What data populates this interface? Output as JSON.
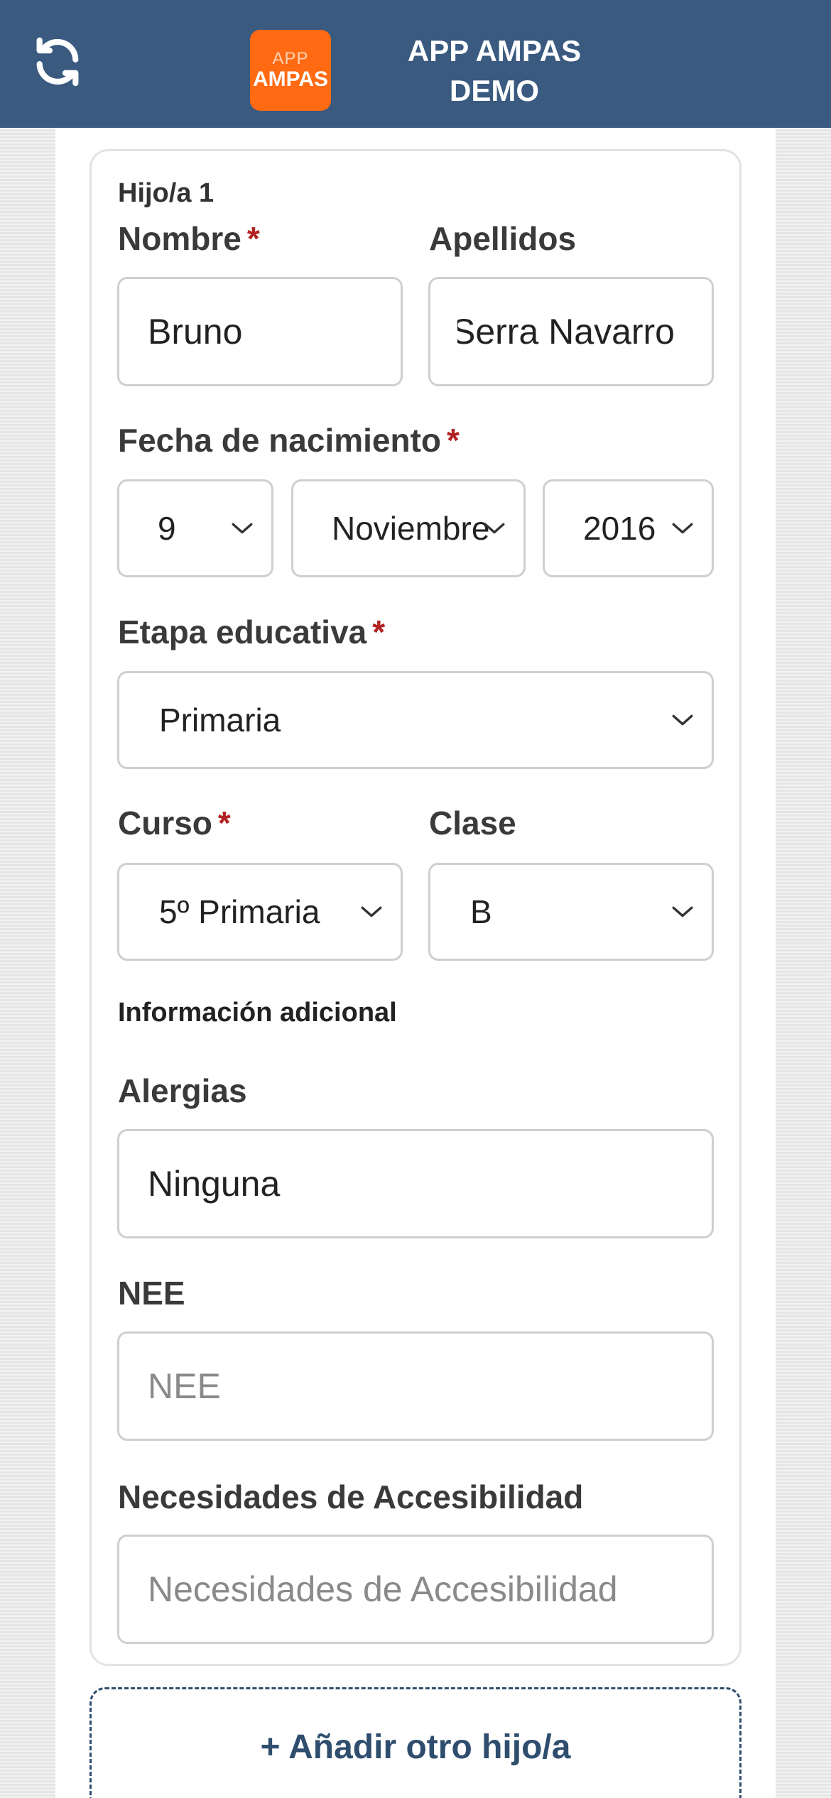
{
  "header": {
    "title_line1": "APP AMPAS",
    "title_line2": "DEMO",
    "logo_top": "APP",
    "logo_bottom": "AMPAS"
  },
  "child": {
    "heading": "Hijo/a 1",
    "required_mark": "*",
    "nombre": {
      "label": "Nombre",
      "value": "Bruno"
    },
    "apellidos": {
      "label": "Apellidos",
      "value": "Serra Navarro"
    },
    "fecha": {
      "label": "Fecha de nacimiento",
      "day": "9",
      "month": "Noviembre",
      "year": "2016"
    },
    "etapa": {
      "label": "Etapa educativa",
      "value": "Primaria"
    },
    "curso": {
      "label": "Curso",
      "value": "5º Primaria"
    },
    "clase": {
      "label": "Clase",
      "value": "B"
    },
    "info_heading": "Información adicional",
    "alergias": {
      "label": "Alergias",
      "value": "Ninguna"
    },
    "nee": {
      "label": "NEE",
      "placeholder": "NEE"
    },
    "accesibilidad": {
      "label": "Necesidades de Accesibilidad",
      "placeholder": "Necesidades de Accesibilidad"
    }
  },
  "add_child_label": "+ Añadir otro hijo/a",
  "colors": {
    "header": "#3a5a80",
    "logo": "#ff6a13",
    "required": "#b22222",
    "accent": "#2f4e6e"
  }
}
